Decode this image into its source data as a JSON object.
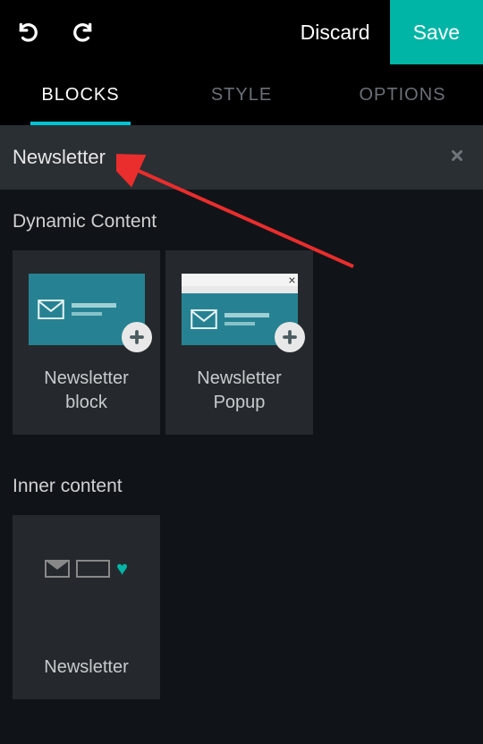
{
  "toolbar": {
    "discard_label": "Discard",
    "save_label": "Save"
  },
  "tabs": {
    "blocks": "BLOCKS",
    "style": "STYLE",
    "options": "OPTIONS",
    "active": "blocks"
  },
  "search": {
    "value": "Newsletter"
  },
  "sections": [
    {
      "title": "Dynamic Content",
      "blocks": [
        {
          "label": "Newsletter block"
        },
        {
          "label": "Newsletter Popup"
        }
      ]
    },
    {
      "title": "Inner content",
      "blocks": [
        {
          "label": "Newsletter"
        }
      ]
    }
  ],
  "colors": {
    "accent": "#00b5a5",
    "tab_underline": "#00c5d6",
    "panel": "#25292d",
    "search_bg": "#2a2f33"
  }
}
